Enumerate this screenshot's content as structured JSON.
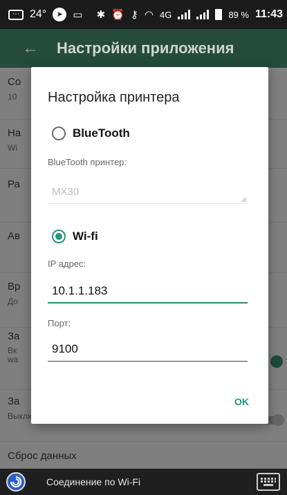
{
  "status_bar": {
    "temperature": "24°",
    "network": "4G",
    "battery": "89 %",
    "time": "11:43"
  },
  "app_bar": {
    "back_icon": "back-arrow-icon",
    "title": "Настройки приложения"
  },
  "background_settings": [
    {
      "title": "Со",
      "sub": "10"
    },
    {
      "title": "На",
      "sub": "Wi"
    },
    {
      "title": "Ра",
      "sub": ""
    },
    {
      "title": "Ав",
      "sub": ""
    },
    {
      "title": "Вр",
      "sub": "До"
    },
    {
      "title": "За",
      "sub": "Вк\nwa"
    },
    {
      "title": "За",
      "sub": "Выключено"
    },
    {
      "title": "Сброс данных",
      "sub": ""
    }
  ],
  "dialog": {
    "title": "Настройка принтера",
    "bluetooth": {
      "label": "BlueTooth",
      "checked": false,
      "field_label": "BlueTooth принтер:",
      "field_value": "MX30"
    },
    "wifi": {
      "label": "Wi-fi",
      "checked": true,
      "ip_label": "IP адрес:",
      "ip_value": "10.1.1.183",
      "port_label": "Порт:",
      "port_value": "9100"
    },
    "ok_label": "OK"
  },
  "bottom_bar": {
    "text": "Соединение по Wi-Fi",
    "keyboard_icon": "keyboard-icon"
  },
  "colors": {
    "accent": "#1e9a7a",
    "app_bar": "#254b3c",
    "status_bar": "#1b1b1b"
  }
}
